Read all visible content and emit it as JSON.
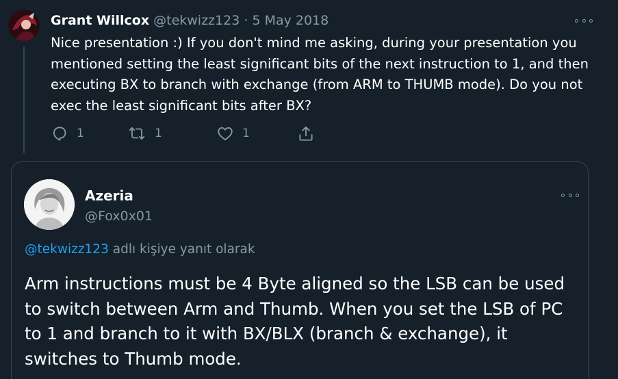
{
  "parent": {
    "name": "Grant Willcox",
    "handle": "@tekwizz123",
    "separator": "·",
    "date": "5 May 2018",
    "text": "Nice presentation :) If you don't mind me asking, during your presentation you mentioned setting the least significant bits of the next instruction to 1, and then executing BX to branch with exchange (from ARM to THUMB mode). Do you not exec the least significant bits after BX?",
    "reply_count": "1",
    "retweet_count": "1",
    "like_count": "1"
  },
  "reply": {
    "name": "Azeria",
    "handle": "@Fox0x01",
    "replying_to_handle": "@tekwizz123",
    "replying_to_suffix": "adlı kişiye yanıt olarak",
    "text": "Arm instructions must be 4 Byte aligned so the LSB can be used to switch between Arm and Thumb. When you set the LSB of PC to 1 and branch to it with BX/BLX (branch & exchange), it switches to Thumb mode."
  },
  "colors": {
    "background": "#15202b",
    "muted": "#8899a6",
    "accent": "#1da1f2",
    "border": "#38444d"
  },
  "icons": {
    "reply": "reply-icon",
    "retweet": "retweet-icon",
    "like": "heart-icon",
    "share": "share-icon",
    "more": "more-icon"
  }
}
